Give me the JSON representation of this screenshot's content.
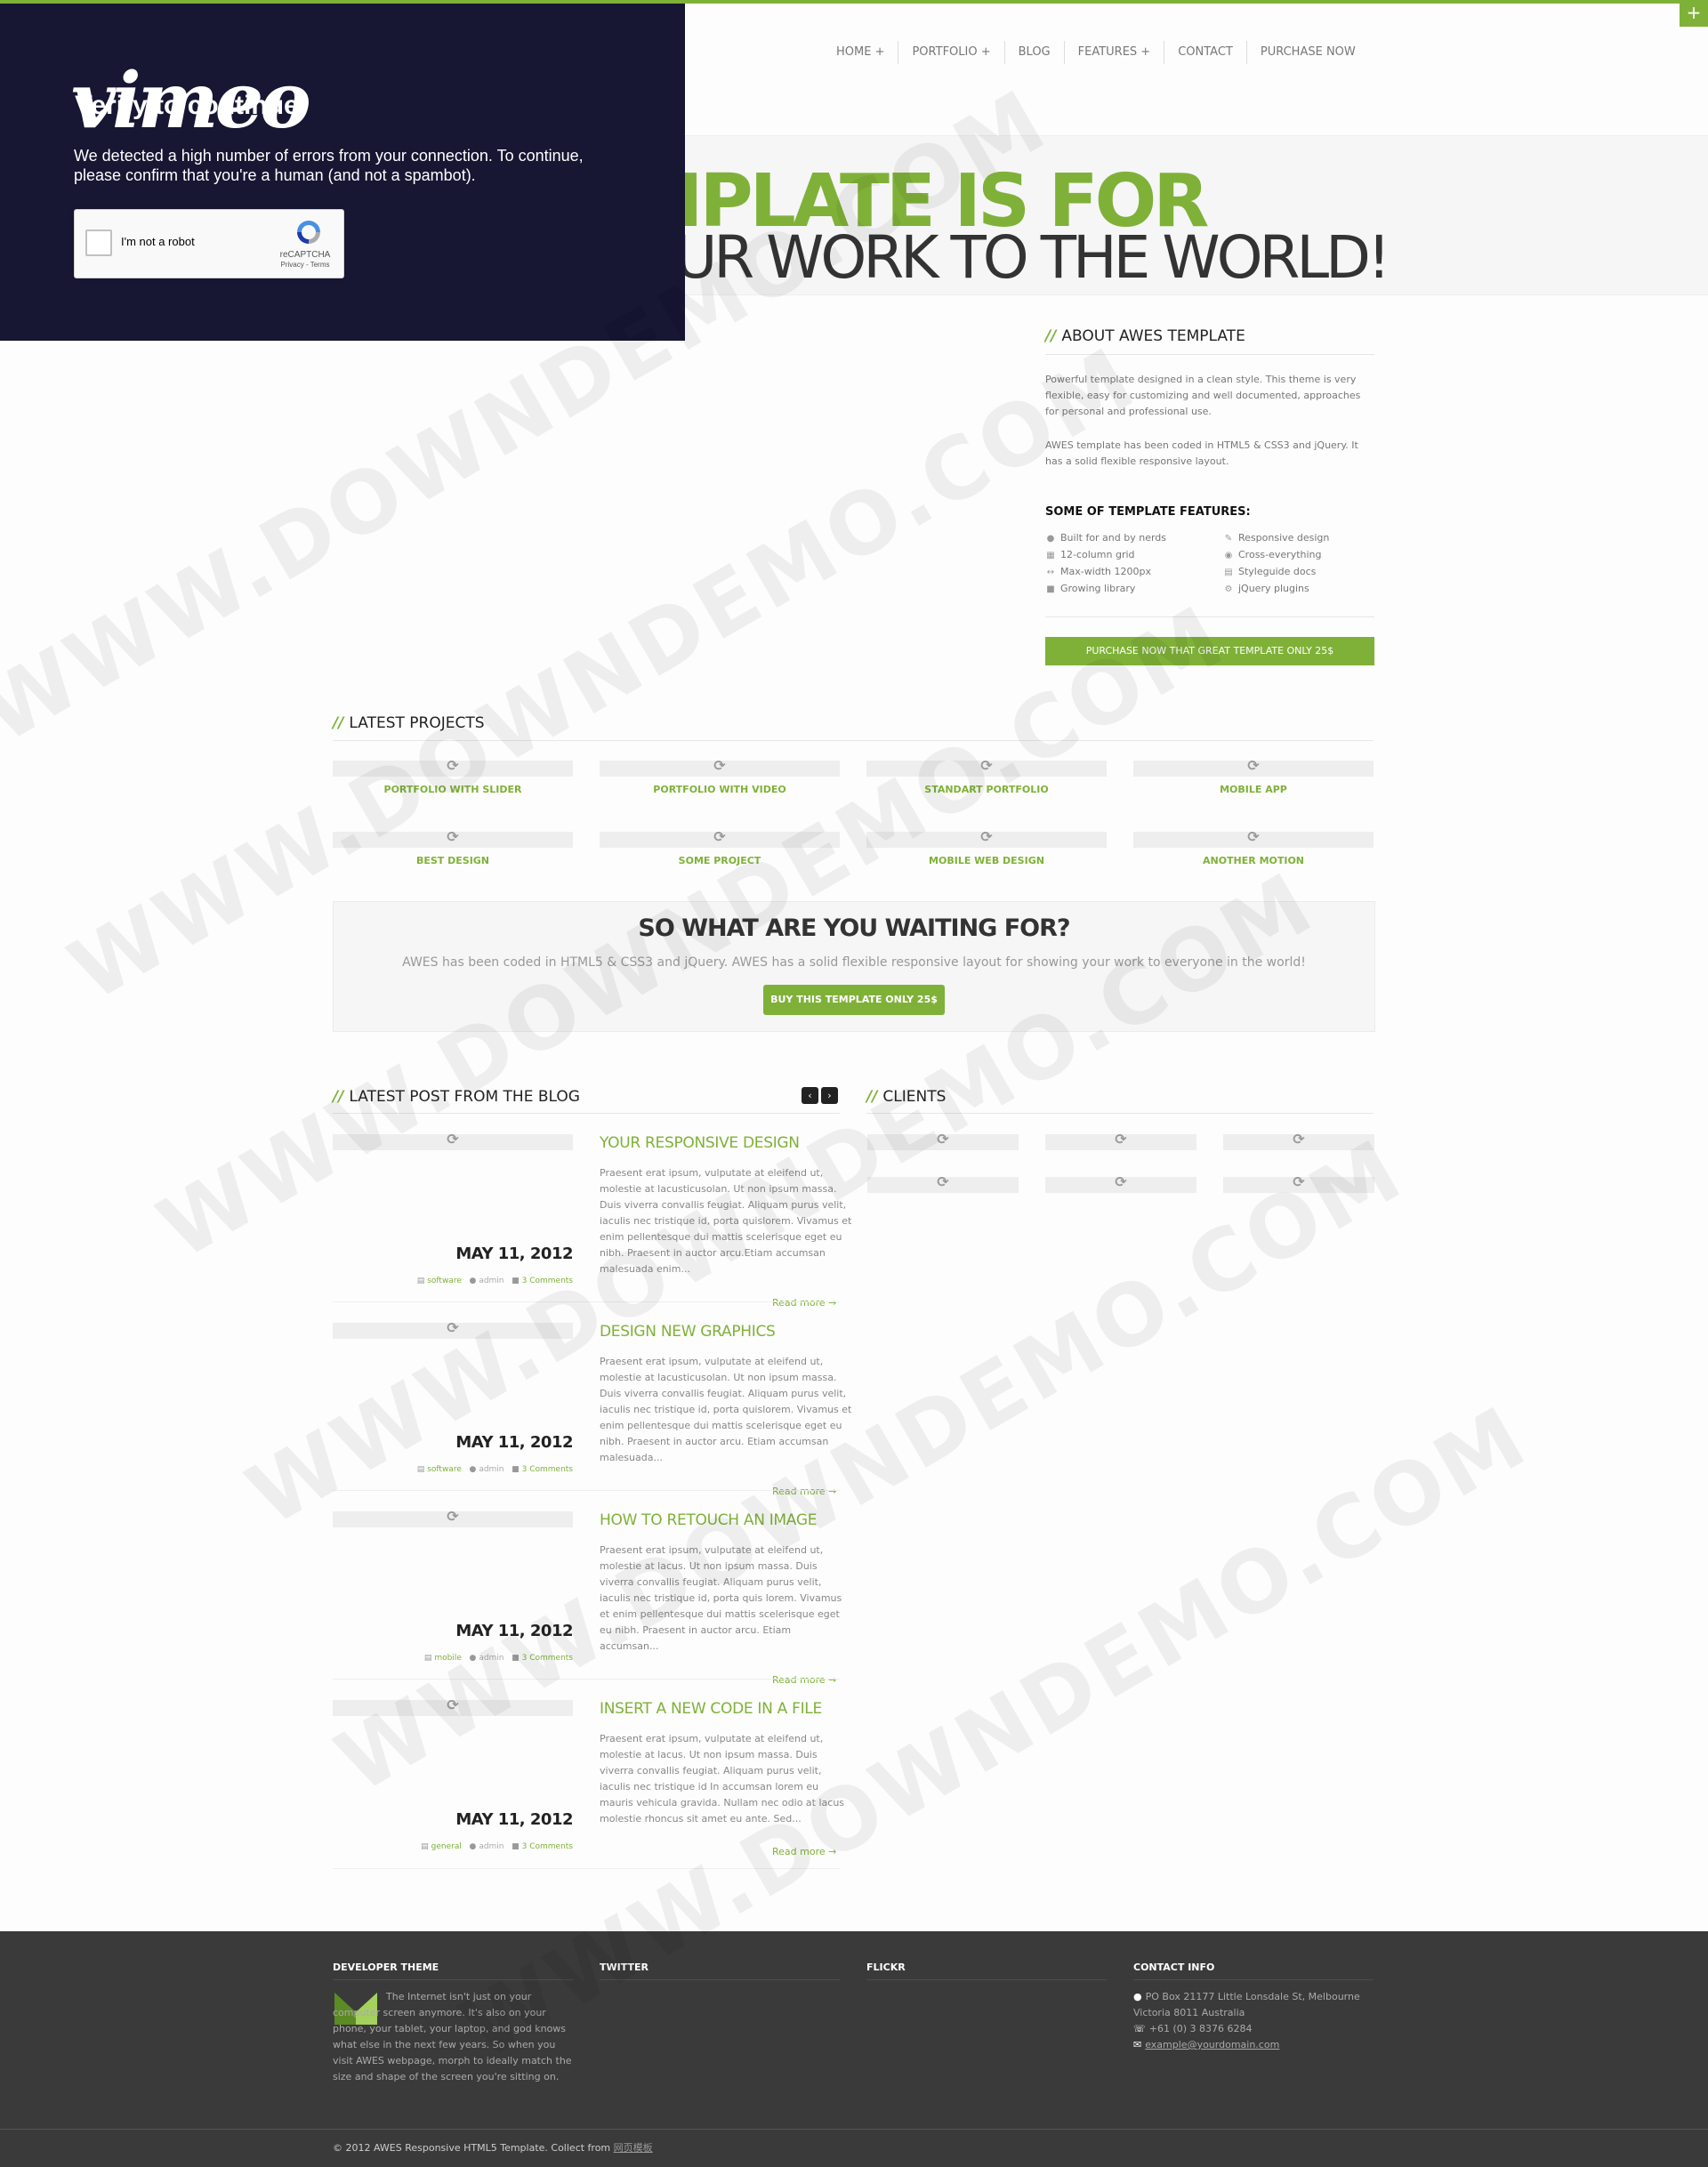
{
  "header": {
    "plus_label": "+",
    "nav": [
      "HOME +",
      "PORTFOLIO +",
      "BLOG",
      "FEATURES +",
      "CONTACT",
      "PURCHASE NOW"
    ]
  },
  "hero": {
    "line1": "IPLATE IS FOR",
    "line2": "UR WORK TO THE WORLD!",
    "fragment": "?"
  },
  "vimeo_overlay": {
    "logo": "vimeo",
    "title": "Verify to continue",
    "message": "We detected a high number of errors from your connection. To continue, please confirm that you're a human (and not a spambot).",
    "captcha_label": "I'm not a robot",
    "captcha_brand": "reCAPTCHA",
    "captcha_links": "Privacy - Terms"
  },
  "about": {
    "title": "ABOUT AWES TEMPLATE",
    "p1": "Powerful template designed in a clean style. This theme is very flexible, easy for customizing and well documented, approaches for personal and professional use.",
    "p2": "AWES template has been coded in HTML5 & CSS3 and jQuery. It has a solid flexible responsive layout.",
    "features_title": "SOME OF TEMPLATE FEATURES:",
    "features_left": [
      {
        "icon": "user-icon",
        "label": "Built for and by nerds"
      },
      {
        "icon": "grid-icon",
        "label": "12-column grid"
      },
      {
        "icon": "resize-icon",
        "label": "Max-width 1200px"
      },
      {
        "icon": "book-icon",
        "label": "Growing library"
      }
    ],
    "features_right": [
      {
        "icon": "pencil-icon",
        "label": "Responsive design"
      },
      {
        "icon": "eye-icon",
        "label": "Cross-everything"
      },
      {
        "icon": "doc-icon",
        "label": "Styleguide docs"
      },
      {
        "icon": "gear-icon",
        "label": "jQuery plugins"
      }
    ],
    "button": "PURCHASE NOW THAT GREAT TEMPLATE ONLY 25$"
  },
  "projects": {
    "title": "LATEST PROJECTS",
    "items": [
      "PORTFOLIO WITH SLIDER",
      "PORTFOLIO WITH VIDEO",
      "STANDART PORTFOLIO",
      "MOBILE APP",
      "BEST DESIGN",
      "SOME PROJECT",
      "MOBILE WEB DESIGN",
      "ANOTHER MOTION"
    ]
  },
  "cta": {
    "title": "SO WHAT ARE YOU WAITING FOR?",
    "subtitle": "AWES has been coded in HTML5 & CSS3 and jQuery. AWES has a solid flexible responsive layout for showing your work to everyone in the world!",
    "button": "BUY THIS TEMPLATE ONLY 25$"
  },
  "blog": {
    "title": "LATEST POST FROM THE BLOG",
    "prev": "‹",
    "next": "›",
    "posts": [
      {
        "date": "MAY 11, 2012",
        "category": "software",
        "author": "admin",
        "comments": "3 Comments",
        "title": "YOUR RESPONSIVE DESIGN",
        "text": "Praesent erat ipsum, vulputate at eleifend ut, molestie at lacusticusolan. Ut non ipsum massa. Duis viverra convallis feugiat. Aliquam purus velit, iaculis nec tristique id, porta quislorem. Vivamus et enim pellentesque dui mattis scelerisque eget eu nibh. Praesent in auctor arcu.Etiam accumsan malesuada enim...",
        "read_more": "Read more →"
      },
      {
        "date": "MAY 11, 2012",
        "category": "software",
        "author": "admin",
        "comments": "3 Comments",
        "title": "DESIGN NEW GRAPHICS",
        "text": "Praesent erat ipsum, vulputate at eleifend ut, molestie at lacusticusolan. Ut non ipsum massa. Duis viverra convallis feugiat. Aliquam purus velit, iaculis nec tristique id, porta quislorem. Vivamus et enim pellentesque dui mattis scelerisque eget eu nibh. Praesent in auctor arcu. Etiam accumsan malesuada...",
        "read_more": "Read more →"
      },
      {
        "date": "MAY 11, 2012",
        "category": "mobile",
        "author": "admin",
        "comments": "3 Comments",
        "title": "HOW TO RETOUCH AN IMAGE",
        "text": "Praesent erat ipsum, vulputate at eleifend ut, molestie at lacus. Ut non ipsum massa. Duis viverra convallis feugiat. Aliquam purus velit, iaculis nec tristique id, porta quis lorem. Vivamus et enim pellentesque dui mattis scelerisque eget eu nibh. Praesent in auctor arcu. Etiam accumsan...",
        "read_more": "Read more →"
      },
      {
        "date": "MAY 11, 2012",
        "category": "general",
        "author": "admin",
        "comments": "3 Comments",
        "title": "INSERT A NEW CODE IN A FILE",
        "text": "Praesent erat ipsum, vulputate at eleifend ut, molestie at lacus. Ut non ipsum massa. Duis viverra convallis feugiat. Aliquam purus velit, iaculis nec tristique id In accumsan lorem eu mauris vehicula gravida. Nullam nec odio at lacus molestie rhoncus sit amet eu ante. Sed...",
        "read_more": "Read more →"
      }
    ]
  },
  "clients": {
    "title": "CLIENTS"
  },
  "footer": {
    "dev_title": "DEVELOPER THEME",
    "dev_text": "The Internet isn't just on your computer screen anymore. It's also on your phone, your tablet, your laptop, and god knows what else in the next few years. So when you visit AWES webpage, morph to ideally match the size and shape of the screen you're sitting on.",
    "twitter_title": "TWITTER",
    "flickr_title": "FLICKR",
    "contact_title": "CONTACT INFO",
    "address": "PO Box 21177 Little Lonsdale St, Melbourne Victoria 8011 Australia",
    "phone": "+61 (0) 3 8376 6284",
    "email": "example@yourdomain.com",
    "copyright": "© 2012 AWES Responsive HTML5 Template. Collect from ",
    "copyright_link": "网页模板"
  },
  "watermark": "WWW.DOWNDEMO.COM",
  "colors": {
    "accent": "#7fb138",
    "overlay": "#171633",
    "footer": "#3a3a3a"
  }
}
